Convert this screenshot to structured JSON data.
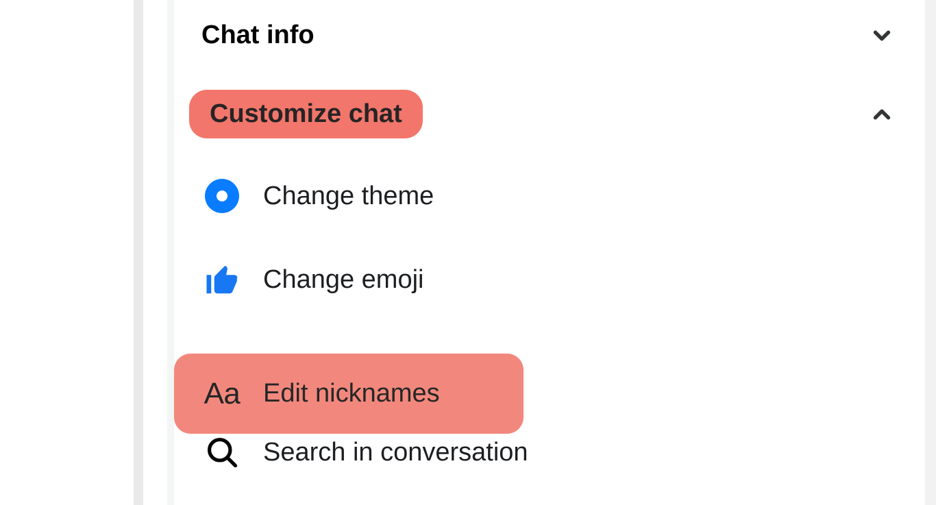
{
  "sections": {
    "chat_info": {
      "title": "Chat info",
      "expanded": false
    },
    "customize": {
      "title": "Customize chat",
      "expanded": true,
      "items": {
        "change_theme": "Change theme",
        "change_emoji": "Change emoji",
        "edit_nicknames": "Edit nicknames",
        "search": "Search in conversation"
      }
    }
  },
  "icons": {
    "aa": "Aa"
  },
  "colors": {
    "highlight_pill": "#f2766b",
    "highlight_row": "#f2887d",
    "theme_blue": "#0a7cff",
    "thumbs_blue": "#1877f2"
  }
}
